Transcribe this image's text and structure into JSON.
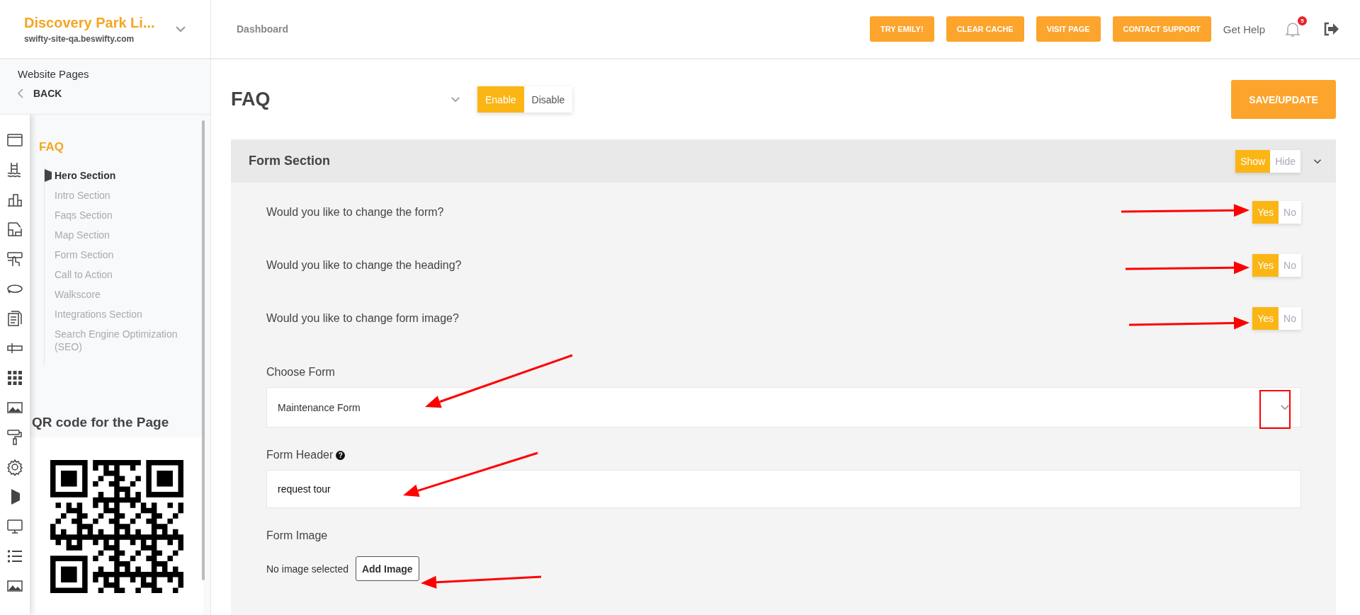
{
  "header": {
    "site_name": "Discovery Park Li...",
    "site_url": "swifty-site-qa.beswifty.com",
    "breadcrumb": "Dashboard",
    "buttons": [
      "TRY EMILY!",
      "CLEAR CACHE",
      "VISIT PAGE",
      "CONTACT SUPPORT"
    ],
    "help_link": "Get Help",
    "notification_count": "5"
  },
  "sidebar": {
    "title": "Website Pages",
    "back_label": "BACK",
    "icon_rail": [
      {
        "selected": false
      },
      {
        "selected": false
      },
      {
        "selected": false
      },
      {
        "selected": false
      },
      {
        "selected": false
      },
      {
        "selected": false
      },
      {
        "selected": false
      },
      {
        "selected": false
      },
      {
        "selected": false
      },
      {
        "selected": false
      },
      {
        "selected": false
      },
      {
        "selected": false
      },
      {
        "selected": true
      },
      {
        "selected": false
      },
      {
        "selected": false
      },
      {
        "selected": false
      }
    ],
    "page_title": "FAQ",
    "sections": [
      {
        "label": "Hero Section",
        "selected": true
      },
      {
        "label": "Intro Section",
        "selected": false
      },
      {
        "label": "Faqs Section",
        "selected": false
      },
      {
        "label": "Map Section",
        "selected": false
      },
      {
        "label": "Form Section",
        "selected": false
      },
      {
        "label": "Call to Action",
        "selected": false
      },
      {
        "label": "Walkscore",
        "selected": false
      },
      {
        "label": "Integrations Section",
        "selected": false
      },
      {
        "label": "Search Engine Optimization (SEO)",
        "selected": false
      }
    ],
    "qr_title": "QR code for the Page"
  },
  "page": {
    "title": "FAQ",
    "status_toggle": [
      {
        "label": "Enable",
        "selected": true
      },
      {
        "label": "Disable",
        "selected": false
      }
    ],
    "save_button": "SAVE/UPDATE"
  },
  "form_section": {
    "title": "Form Section",
    "visibility": [
      {
        "label": "Show",
        "selected": true
      },
      {
        "label": "Hide",
        "selected": false
      }
    ],
    "questions": [
      {
        "text": "Would you like to change the form?",
        "options": [
          {
            "label": "Yes",
            "selected": true
          },
          {
            "label": "No",
            "selected": false
          }
        ]
      },
      {
        "text": "Would you like to change the heading?",
        "options": [
          {
            "label": "Yes",
            "selected": true
          },
          {
            "label": "No",
            "selected": false
          }
        ]
      },
      {
        "text": "Would you like to change form image?",
        "options": [
          {
            "label": "Yes",
            "selected": true
          },
          {
            "label": "No",
            "selected": false
          }
        ]
      }
    ],
    "choose_form": {
      "label": "Choose Form",
      "value": "Maintenance Form"
    },
    "form_header": {
      "label": "Form Header",
      "help_mark": "?",
      "value": "request tour"
    },
    "form_image": {
      "label": "Form Image",
      "status": "No image selected",
      "button": "Add Image"
    }
  }
}
